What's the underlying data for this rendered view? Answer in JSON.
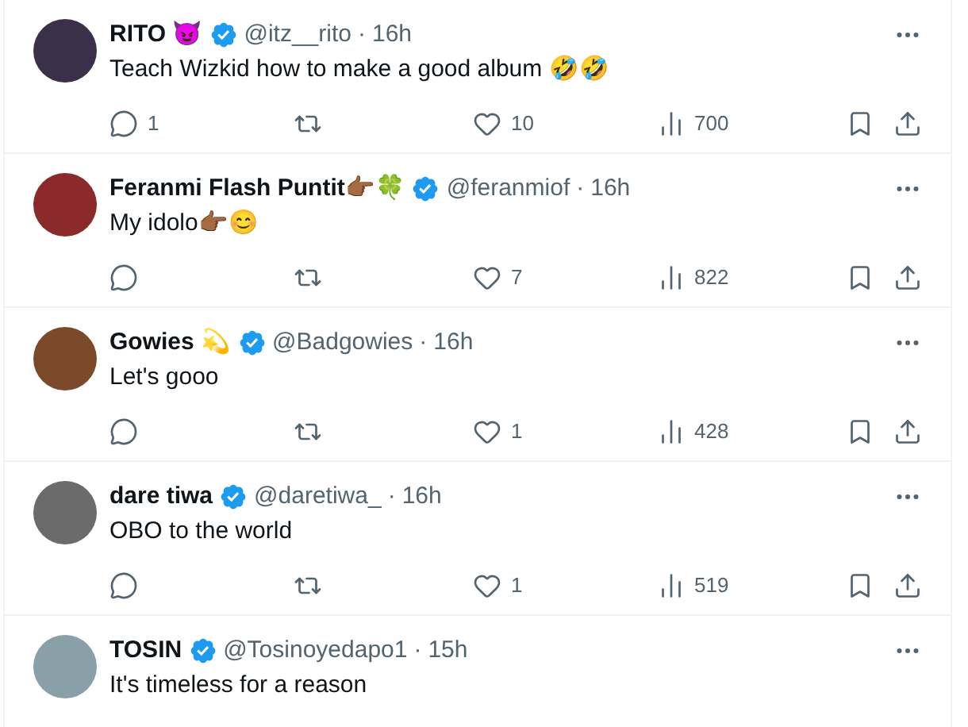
{
  "replies": [
    {
      "name": "RITO 😈",
      "verified": true,
      "handle": "@itz__rito",
      "separator": "·",
      "time": "16h",
      "text": "Teach Wizkid how to make a good album 🤣🤣",
      "actions": {
        "replies": "1",
        "likes": "10",
        "views": "700"
      }
    },
    {
      "name": "Feranmi Flash Puntit👉🏾🍀",
      "verified": true,
      "handle": "@feranmiof",
      "separator": "·",
      "time": "16h",
      "text": "My idolo👉🏾😊",
      "actions": {
        "likes": "7",
        "views": "822"
      }
    },
    {
      "name": "Gowies 💫",
      "verified": true,
      "handle": "@Badgowies",
      "separator": "·",
      "time": "16h",
      "text": "Let's gooo",
      "actions": {
        "likes": "1",
        "views": "428"
      }
    },
    {
      "name": "dare tiwa",
      "verified": true,
      "handle": "@daretiwa_",
      "separator": "·",
      "time": "16h",
      "text": "OBO to the world",
      "actions": {
        "likes": "1",
        "views": "519"
      }
    },
    {
      "name": "TOSIN",
      "verified": true,
      "handle": "@Tosinoyedapo1",
      "separator": "·",
      "time": "15h",
      "text": "It's timeless for a reason"
    }
  ]
}
